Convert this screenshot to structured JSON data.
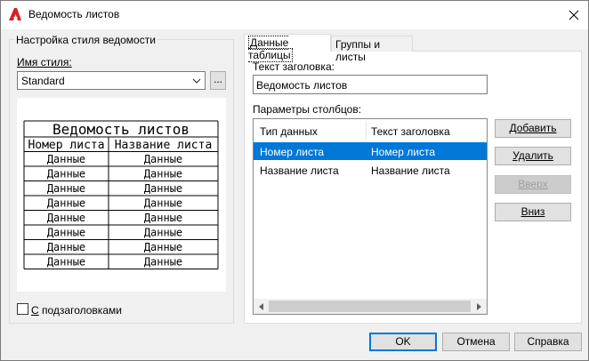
{
  "window": {
    "title": "Ведомость листов"
  },
  "style_group": {
    "label": "Настройка стиля ведомости",
    "style_name_label": "Имя стиля:",
    "style_value": "Standard",
    "browse_label": "...",
    "checkbox_label": "С подзаголовками",
    "checkbox_checked": false
  },
  "preview": {
    "title": "Ведомость листов",
    "headers": [
      "Номер листа",
      "Название листа"
    ],
    "data_rows": [
      [
        "Данные",
        "Данные"
      ],
      [
        "Данные",
        "Данные"
      ],
      [
        "Данные",
        "Данные"
      ],
      [
        "Данные",
        "Данные"
      ],
      [
        "Данные",
        "Данные"
      ],
      [
        "Данные",
        "Данные"
      ],
      [
        "Данные",
        "Данные"
      ],
      [
        "Данные",
        "Данные"
      ]
    ]
  },
  "tabs": [
    {
      "label": "Данные таблицы",
      "active": true
    },
    {
      "label": "Группы и листы",
      "active": false
    }
  ],
  "table_data": {
    "header_text_label": "Текст заголовка:",
    "header_text_value": "Ведомость листов",
    "columns_label": "Параметры столбцов:",
    "list_headers": [
      "Тип данных",
      "Текст заголовка"
    ],
    "rows": [
      {
        "type": "Номер листа",
        "header": "Номер листа",
        "selected": true
      },
      {
        "type": "Название листа",
        "header": "Название листа",
        "selected": false
      }
    ]
  },
  "side_buttons": {
    "add": "Добавить",
    "delete": "Удалить",
    "up": "Вверх",
    "down": "Вниз"
  },
  "footer": {
    "ok": "OK",
    "cancel": "Отмена",
    "help": "Справка"
  },
  "colors": {
    "accent": "#0078d7",
    "app_icon": "#d4202a"
  }
}
